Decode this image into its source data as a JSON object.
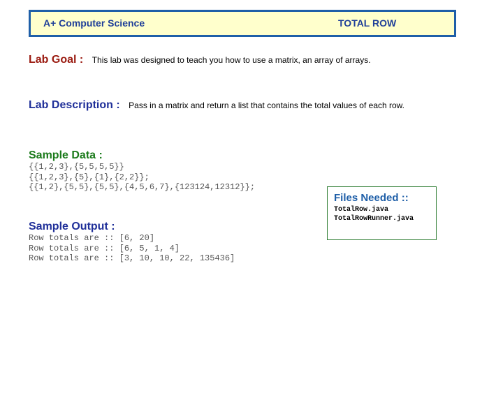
{
  "header": {
    "title": "A+ Computer Science",
    "topic": "TOTAL ROW"
  },
  "lab_goal": {
    "label": "Lab Goal :",
    "text": "This lab was designed to teach you how to use a matrix, an array of arrays."
  },
  "lab_description": {
    "label": "Lab Description :",
    "text": "Pass in a matrix and return a list that contains the total values of each row."
  },
  "sample_data": {
    "label": "Sample Data :",
    "lines": [
      "{{1,2,3},{5,5,5,5}}",
      "{{1,2,3},{5},{1},{2,2}};",
      "{{1,2},{5,5},{5,5},{4,5,6,7},{123124,12312}};"
    ]
  },
  "sample_output": {
    "label": "Sample Output :",
    "lines": [
      "Row totals are :: [6, 20]",
      "Row totals are :: [6, 5, 1, 4]",
      "Row totals are :: [3, 10, 10, 22, 135436]"
    ]
  },
  "files_needed": {
    "label": "Files Needed ::",
    "files": [
      "TotalRow.java",
      "TotalRowRunner.java"
    ]
  }
}
